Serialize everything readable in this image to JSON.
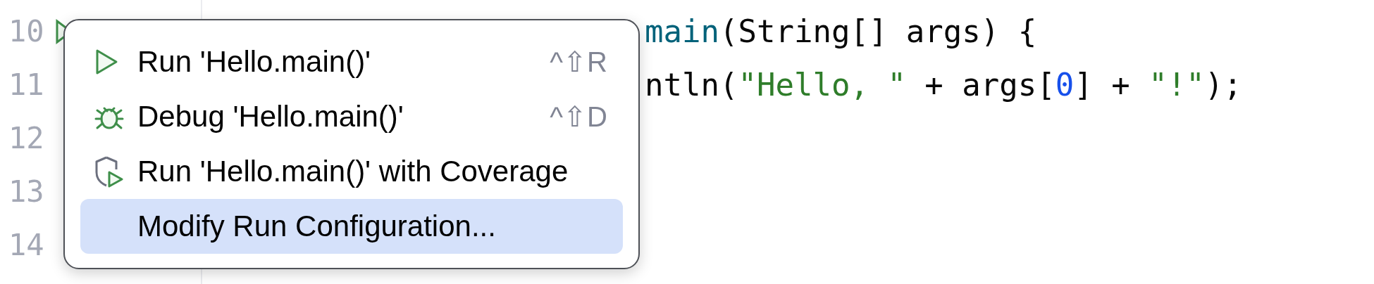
{
  "gutter": {
    "line_numbers": [
      "10",
      "11",
      "12",
      "13",
      "14"
    ]
  },
  "code_lines": [
    {
      "tokens": [
        {
          "text": "main",
          "kind": "method"
        },
        {
          "text": "(String[] args) {",
          "kind": "plain"
        }
      ]
    },
    {
      "tokens": [
        {
          "text": "ntln(",
          "kind": "plain"
        },
        {
          "text": "\"Hello, \"",
          "kind": "string"
        },
        {
          "text": " + args[",
          "kind": "plain"
        },
        {
          "text": "0",
          "kind": "number"
        },
        {
          "text": "] + ",
          "kind": "plain"
        },
        {
          "text": "\"!\"",
          "kind": "string"
        },
        {
          "text": ");",
          "kind": "plain"
        }
      ]
    }
  ],
  "popup_menu": {
    "items": [
      {
        "label": "Run 'Hello.main()'",
        "kind": "run",
        "shortcut": "^⇧R",
        "selected": false
      },
      {
        "label": "Debug 'Hello.main()'",
        "kind": "debug",
        "shortcut": "^⇧D",
        "selected": false
      },
      {
        "label": "Run 'Hello.main()' with Coverage",
        "kind": "coverage",
        "selected": false
      },
      {
        "label": "Modify Run Configuration...",
        "kind": "plain",
        "selected": true
      }
    ]
  }
}
